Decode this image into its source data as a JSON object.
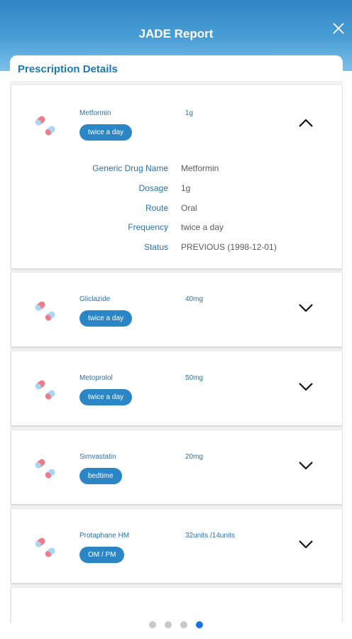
{
  "header": {
    "title": "JADE Report"
  },
  "section": {
    "title": "Prescription Details"
  },
  "prescriptions": [
    {
      "name": "Metformin",
      "dose": "1g",
      "frequency": "twice a day",
      "expanded": true
    },
    {
      "name": "Gliclazide",
      "dose": "40mg",
      "frequency": "twice a day",
      "expanded": false
    },
    {
      "name": "Metoprolol",
      "dose": "50mg",
      "frequency": "twice a day",
      "expanded": false
    },
    {
      "name": "Simvastatin",
      "dose": "20mg",
      "frequency": "bedtime",
      "expanded": false
    },
    {
      "name": "Protaphane HM",
      "dose": "32units /14units",
      "frequency": "OM / PM",
      "expanded": false
    }
  ],
  "details": {
    "labels": [
      "Generic Drug Name",
      "Dosage",
      "Route",
      "Frequency",
      "Status"
    ],
    "separator": ":",
    "values": [
      "Metformin",
      "1g",
      "Oral",
      "twice a day",
      "PREVIOUS (1998-12-01)"
    ]
  },
  "pager": {
    "count": 4,
    "active_index": 3
  },
  "colors": {
    "header_gradient": [
      "#2f86c2",
      "#7cc0ea"
    ],
    "accent": "#2a86c4",
    "label_text": "#2673ad",
    "value_text": "#5b5b5b",
    "pill_blue": "#a9d6f3",
    "pill_red": "#ef7d88",
    "dot_active": "#1a73e8",
    "dot_inactive": "#c8c8c8"
  },
  "icons": [
    "close-icon",
    "pill-icon",
    "chevron-up-icon",
    "chevron-down-icon"
  ]
}
